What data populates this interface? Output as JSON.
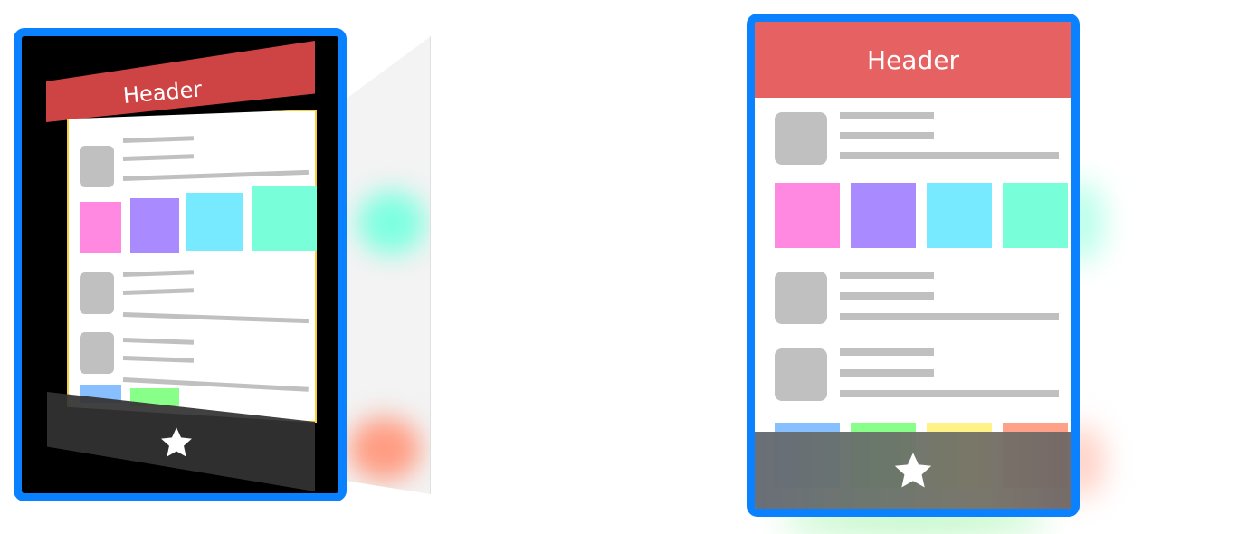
{
  "header": {
    "label": "Header"
  },
  "colors": {
    "frame_border": "#0a82ff",
    "header": "#e66262",
    "header_3d": "#d94848",
    "selection_outline": "#f5d23a",
    "placeholder": "#c0c0c0",
    "swatches": [
      "#ff88e0",
      "#a98aff",
      "#78eaff",
      "#78ffd9"
    ],
    "swatches_row2": [
      "#88bfff",
      "#88ff88",
      "#fff388",
      "#ffa088"
    ]
  },
  "tab_bar": {
    "icon": "star-icon"
  },
  "views": [
    "exploded-3d-layers",
    "flat-composite"
  ]
}
